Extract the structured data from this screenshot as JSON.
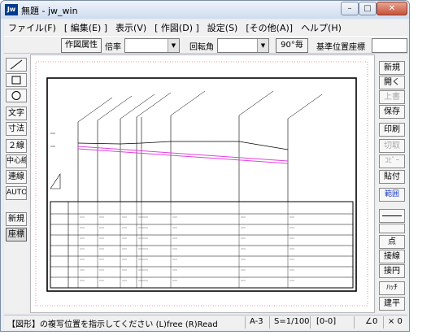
{
  "window": {
    "title": "無題 - jw_win",
    "icon_label": "Jw",
    "controls": {
      "minimize": "–",
      "maximize": "□",
      "close": "✕"
    }
  },
  "menu": [
    "ファイル(F)",
    "[ 編集(E) ]",
    "表示(V)",
    "[ 作図(D) ]",
    "設定(S)",
    "[その他(A)]",
    "ヘルプ(H)"
  ],
  "toolbar": {
    "attr_button": "作図属性",
    "scale_label": "倍率",
    "scale_value": "",
    "rotation_label": "回転角",
    "rotation_value": "",
    "deg90_button": "90°毎",
    "base_label": "基準位置座標",
    "base_value": ""
  },
  "left_tools": [
    "／",
    "□",
    "○",
    "文字",
    "寸法",
    "２線",
    "中心線",
    "連線",
    "AUTO",
    "新規",
    "座標"
  ],
  "right_tools": [
    "新規",
    "開く",
    "上書",
    "保存",
    "印刷",
    "切取",
    "ｺﾋﾟｰ",
    "貼付",
    "範囲",
    "",
    "",
    "点",
    "接線",
    "接円",
    "ﾊｯﾁ",
    "建平"
  ],
  "status": {
    "message": "【図形】の複写位置を指示してください (L)free (R)Read",
    "paper": "A-3",
    "scale": "S=1/100",
    "layer": "[0-0]",
    "angle": "∠0",
    "extra": "× 0"
  },
  "colors": {
    "title_gradient_top": "#eef3fb",
    "frame": "#7a8ca4",
    "close_button": "#c6523a",
    "profile_magenta": "#e040e0",
    "highlight_blue": "#1a3cc8"
  }
}
